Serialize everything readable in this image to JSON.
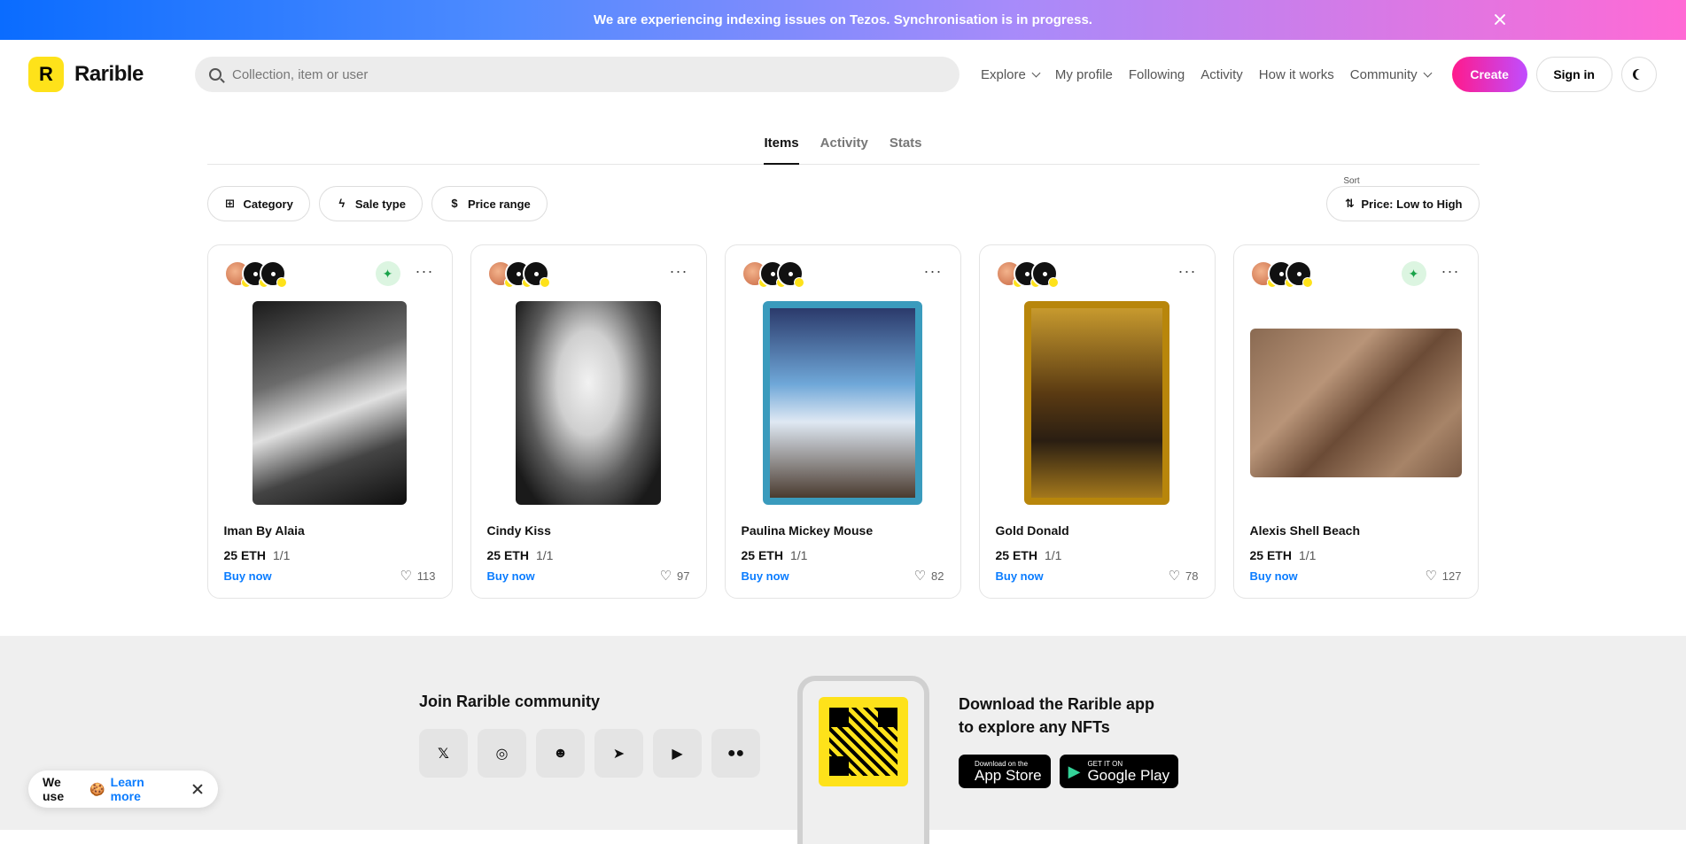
{
  "banner": {
    "message": "We are experiencing indexing issues on Tezos. Synchronisation is in progress."
  },
  "header": {
    "logo_letter": "R",
    "logo_text": "Rarible",
    "search_placeholder": "Collection, item or user",
    "nav": [
      "Explore",
      "My profile",
      "Following",
      "Activity",
      "How it works",
      "Community"
    ],
    "create_label": "Create",
    "signin_label": "Sign in"
  },
  "tabs": [
    "Items",
    "Activity",
    "Stats"
  ],
  "filters": {
    "category": "Category",
    "sale_type": "Sale type",
    "price_range": "Price range"
  },
  "sort": {
    "label": "Sort",
    "value": "Price: Low to High"
  },
  "cards": [
    {
      "name": "Iman By Alaia",
      "price": "25 ETH",
      "edition": "1/1",
      "buy": "Buy now",
      "likes": "113"
    },
    {
      "name": "Cindy Kiss",
      "price": "25 ETH",
      "edition": "1/1",
      "buy": "Buy now",
      "likes": "97"
    },
    {
      "name": "Paulina Mickey Mouse",
      "price": "25 ETH",
      "edition": "1/1",
      "buy": "Buy now",
      "likes": "82"
    },
    {
      "name": "Gold Donald",
      "price": "25 ETH",
      "edition": "1/1",
      "buy": "Buy now",
      "likes": "78"
    },
    {
      "name": "Alexis Shell Beach",
      "price": "25 ETH",
      "edition": "1/1",
      "buy": "Buy now",
      "likes": "127"
    }
  ],
  "footer": {
    "community_title": "Join Rarible community",
    "download_line1": "Download the Rarible app",
    "download_line2": "to explore any NFTs",
    "appstore_small": "Download on the",
    "appstore_big": "App Store",
    "googleplay_small": "GET IT ON",
    "googleplay_big": "Google Play"
  },
  "cookie": {
    "text": "We use",
    "emoji": "🍪",
    "link": "Learn more"
  },
  "colors": {
    "brand_yellow": "#fee21a",
    "create_gradient": [
      "#ff1a8c",
      "#c04dff"
    ],
    "link_blue": "#0a7cff"
  }
}
